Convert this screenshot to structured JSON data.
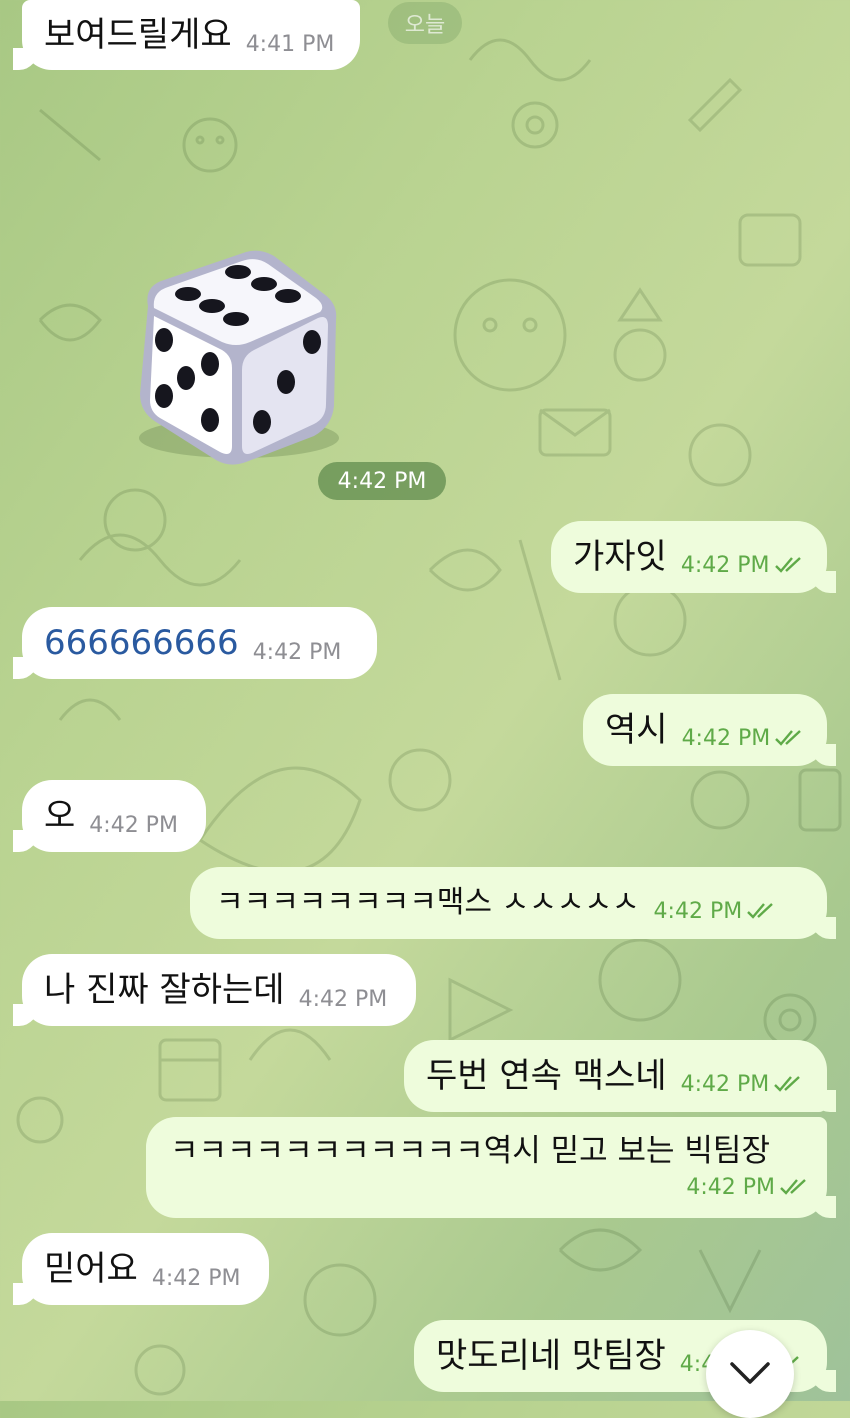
{
  "date_separator": "오늘",
  "dice_value": 6,
  "dice_time": "4:42 PM",
  "messages": [
    {
      "dir": "in",
      "text": "보여드릴게요",
      "time": "4:41 PM"
    },
    {
      "dir": "out",
      "text": "가자잇",
      "time": "4:42 PM"
    },
    {
      "dir": "in",
      "text": "666666666",
      "time": "4:42 PM"
    },
    {
      "dir": "out",
      "text": "역시",
      "time": "4:42 PM"
    },
    {
      "dir": "in",
      "text": "오",
      "time": "4:42 PM"
    },
    {
      "dir": "out",
      "text": "ㅋㅋㅋㅋㅋㅋㅋㅋ맥스 ㅅㅅㅅㅅㅅ",
      "time": "4:42 PM"
    },
    {
      "dir": "in",
      "text": "나 진짜 잘하는데",
      "time": "4:42 PM"
    },
    {
      "dir": "out",
      "text": "두번 연속 맥스네",
      "time": "4:42 PM"
    },
    {
      "dir": "out",
      "text": "ㅋㅋㅋㅋㅋㅋㅋㅋㅋㅋㅋ역시 믿고 보는 빅팀장",
      "time": "4:42 PM"
    },
    {
      "dir": "in",
      "text": "믿어요",
      "time": "4:42 PM"
    },
    {
      "dir": "out",
      "text": "맛도리네 맛팀장",
      "time": "4:42 PM"
    }
  ],
  "colors": {
    "outgoing_bubble": "#eefcdc",
    "incoming_bubble": "#ffffff",
    "outgoing_time": "#5faa48",
    "incoming_time": "#8e8e93",
    "link": "#2a5aa0"
  },
  "icons": {
    "read_receipt": "double-check-icon",
    "scroll_down": "chevron-down-icon",
    "dice": "dice-icon"
  }
}
